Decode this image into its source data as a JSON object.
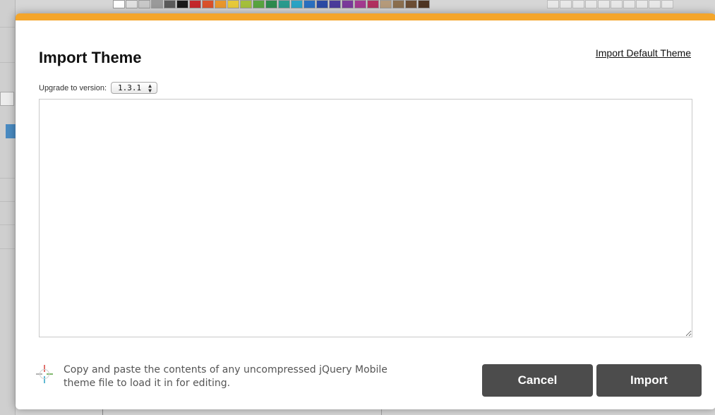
{
  "dialog": {
    "title_bold": "Import",
    "title_rest": " Theme",
    "import_default_link": "Import Default Theme",
    "version_label": "Upgrade to version:",
    "version_selected": "1.3.1",
    "textarea_value": "",
    "help_text": "Copy and paste the contents of any uncompressed jQuery Mobile theme file to load it in for editing.",
    "cancel_label": "Cancel",
    "import_label": "Import"
  },
  "colors": {
    "accent": "#f4a52a",
    "button_bg": "#4c4c4c"
  },
  "palette": [
    "#ffffff",
    "#e0e0e0",
    "#c8c8c8",
    "#9a9a9a",
    "#5a5a5a",
    "#1a1a1a",
    "#c3272b",
    "#d9512a",
    "#e8962c",
    "#e6c93a",
    "#a4bf3b",
    "#58a33f",
    "#2d8a4e",
    "#2a9a8d",
    "#2aa3c4",
    "#2a6fbf",
    "#2c4aa3",
    "#4a3a9a",
    "#7a3a9a",
    "#a33a8f",
    "#b0305f",
    "#b59a7a",
    "#8a6e4e",
    "#6b4d33",
    "#4e3522"
  ],
  "icons": {
    "help": "crosshair-icon",
    "select_arrows": "up-down-arrows-icon",
    "resize": "resize-grip-icon"
  }
}
